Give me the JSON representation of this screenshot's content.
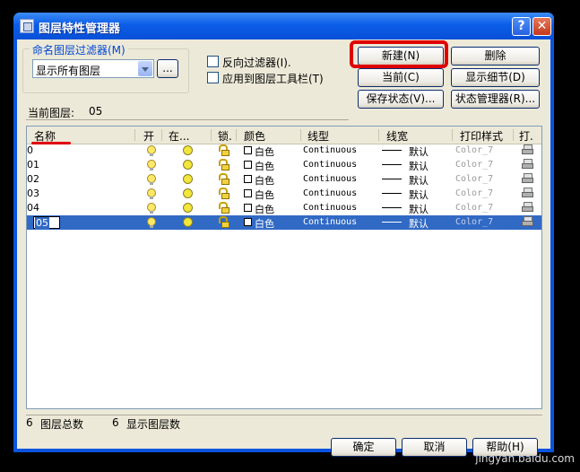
{
  "window": {
    "title": "图层特性管理器",
    "help_btn": "?",
    "close_btn": "✕"
  },
  "filter": {
    "group_label": "命名图层过滤器(M)",
    "combo_value": "显示所有图层",
    "browse_btn": "...",
    "invert_label": "反向过滤器(I).",
    "apply_toolbar_label": "应用到图层工具栏(T)"
  },
  "buttons": {
    "new": "新建(N)",
    "delete": "删除",
    "current": "当前(C)",
    "show_details": "显示细节(D)",
    "save_state": "保存状态(V)...",
    "state_manager": "状态管理器(R)...",
    "ok": "确定",
    "cancel": "取消",
    "help": "帮助(H)"
  },
  "current_layer": {
    "label": "当前图层:",
    "value": "05"
  },
  "columns": [
    "名称",
    "开",
    "在...",
    "锁.",
    "颜色",
    "线型",
    "线宽",
    "打印样式",
    "打."
  ],
  "rows": [
    {
      "name": "0",
      "color": "白色",
      "linetype": "Continuous",
      "lineweight": "默认",
      "plot_style": "Color_7"
    },
    {
      "name": "01",
      "color": "白色",
      "linetype": "Continuous",
      "lineweight": "默认",
      "plot_style": "Color_7"
    },
    {
      "name": "02",
      "color": "白色",
      "linetype": "Continuous",
      "lineweight": "默认",
      "plot_style": "Color_7"
    },
    {
      "name": "03",
      "color": "白色",
      "linetype": "Continuous",
      "lineweight": "默认",
      "plot_style": "Color_7"
    },
    {
      "name": "04",
      "color": "白色",
      "linetype": "Continuous",
      "lineweight": "默认",
      "plot_style": "Color_7"
    },
    {
      "name": "05",
      "color": "白色",
      "linetype": "Continuous",
      "lineweight": "默认",
      "plot_style": "Color_7",
      "selected": true
    }
  ],
  "status": {
    "total_count": "6",
    "total_label": "图层总数",
    "shown_count": "6",
    "shown_label": "显示图层数"
  },
  "watermark": "jingyan.baidu.com",
  "colors": {
    "highlight": "#e00000",
    "selection": "#316ac5",
    "titlebar": "#0b5de8"
  }
}
